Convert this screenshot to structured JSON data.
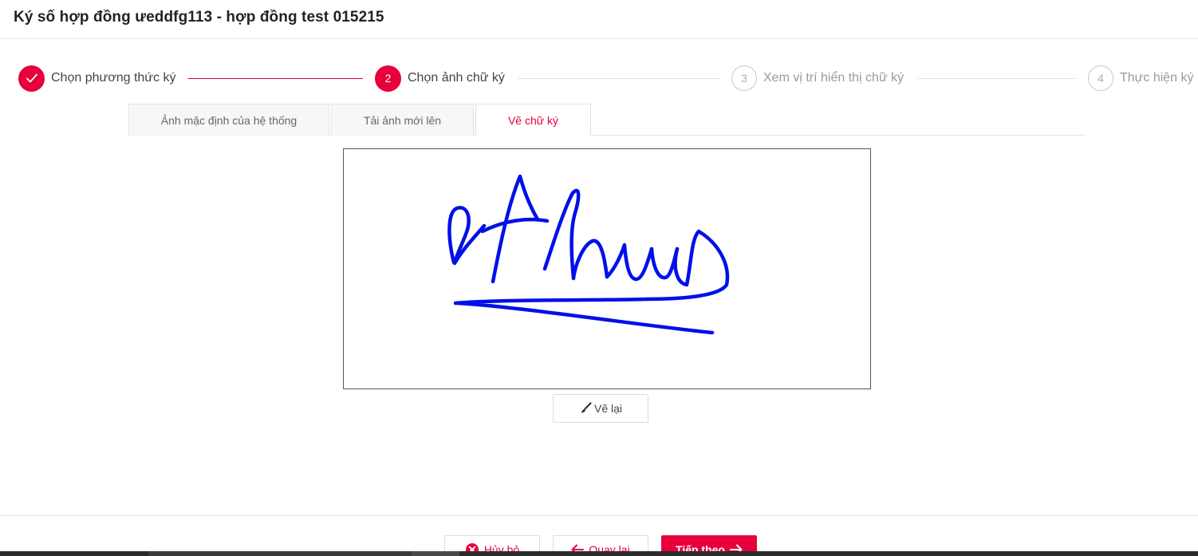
{
  "page": {
    "title": "Ký số hợp đồng ưeddfg113 - hợp đồng test 015215"
  },
  "stepper": {
    "steps": [
      {
        "number": "",
        "label": "Chọn phương thức ký",
        "state": "done",
        "icon": "check-icon"
      },
      {
        "number": "2",
        "label": "Chọn ảnh chữ ký",
        "state": "active"
      },
      {
        "number": "3",
        "label": "Xem vị trí hiển thị chữ ký",
        "state": "pending"
      },
      {
        "number": "4",
        "label": "Thực hiện ký",
        "state": "pending"
      }
    ]
  },
  "tabs": [
    {
      "label": "Ảnh mặc định của hệ thống",
      "active": false
    },
    {
      "label": "Tải ảnh mới lên",
      "active": false
    },
    {
      "label": "Vẽ chữ ký",
      "active": true
    }
  ],
  "signature": {
    "stroke_color": "#0010e8",
    "redraw_label": "Vẽ lại",
    "redraw_icon": "brush-icon"
  },
  "footer": {
    "cancel_label": "Hủy bỏ",
    "cancel_icon": "close-circle-icon",
    "back_label": "Quay lại",
    "back_icon": "arrow-left-icon",
    "next_label": "Tiếp theo",
    "next_icon": "arrow-right-icon"
  },
  "colors": {
    "accent": "#e8003d",
    "pending": "#b0b0b0"
  }
}
